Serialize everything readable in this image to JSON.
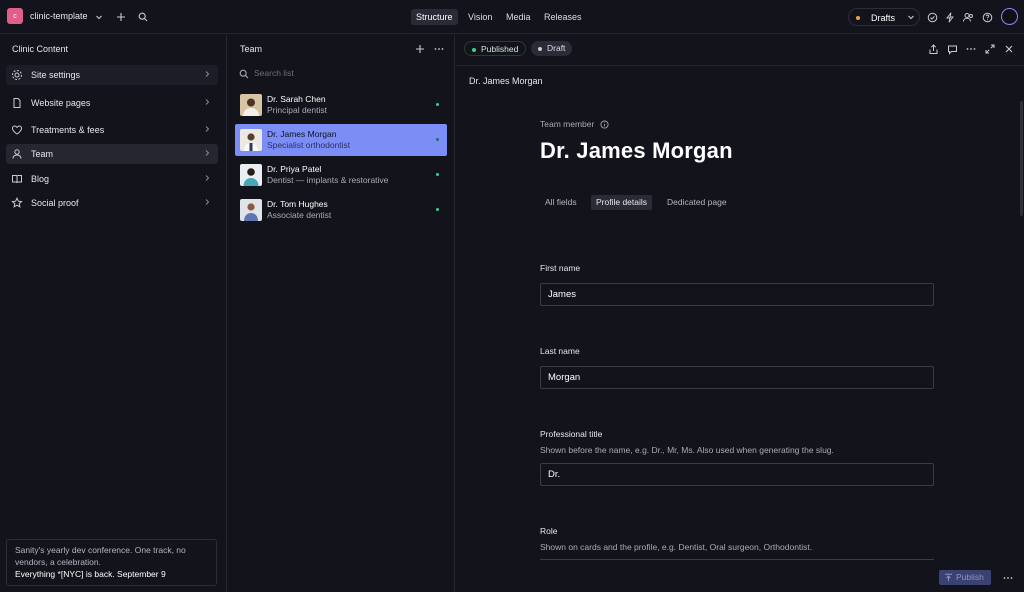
{
  "topbar": {
    "logo_letter": "c",
    "project": "clinic-template",
    "tabs": [
      "Structure",
      "Vision",
      "Media",
      "Releases"
    ],
    "active_tab": "Structure",
    "perspective": "Drafts"
  },
  "sidebar": {
    "title": "Clinic Content",
    "items": [
      {
        "label": "Site settings",
        "icon": "gear-icon"
      },
      {
        "label": "Website pages",
        "icon": "document-icon"
      },
      {
        "label": "Treatments & fees",
        "icon": "heart-icon"
      },
      {
        "label": "Team",
        "icon": "user-icon"
      },
      {
        "label": "Blog",
        "icon": "book-icon"
      },
      {
        "label": "Social proof",
        "icon": "star-icon"
      }
    ],
    "selected": "Team",
    "banner": {
      "text": "Sanity's yearly dev conference. One track, no vendors, a celebration.",
      "strong": "Everything *[NYC] is back. September 9"
    }
  },
  "team_list": {
    "title": "Team",
    "search_placeholder": "Search list",
    "items": [
      {
        "name": "Dr. Sarah Chen",
        "role": "Principal dentist",
        "thumb_color": "#c7a77f"
      },
      {
        "name": "Dr. James Morgan",
        "role": "Specialist orthodontist",
        "thumb_color": "#e7e3df"
      },
      {
        "name": "Dr. Priya Patel",
        "role": "Dentist — implants & restorative",
        "thumb_color": "#5aa8b4"
      },
      {
        "name": "Dr. Tom Hughes",
        "role": "Associate dentist",
        "thumb_color": "#6a7fb4"
      }
    ],
    "selected": "Dr. James Morgan"
  },
  "document": {
    "status_published": "Published",
    "status_draft": "Draft",
    "title": "Dr. James Morgan",
    "type_label": "Team member",
    "heading": "Dr. James Morgan",
    "tabs": [
      "All fields",
      "Profile details",
      "Dedicated page"
    ],
    "active_tab": "Profile details",
    "fields": {
      "first_name": {
        "label": "First name",
        "value": "James"
      },
      "last_name": {
        "label": "Last name",
        "value": "Morgan"
      },
      "professional_title": {
        "label": "Professional title",
        "description": "Shown before the name, e.g. Dr., Mr, Ms. Also used when generating the slug.",
        "value": "Dr."
      },
      "role": {
        "label": "Role",
        "description": "Shown on cards and the profile, e.g. Dentist, Oral surgeon, Orthodontist."
      }
    },
    "publish_label": "Publish"
  },
  "colors": {
    "background": "#13141b",
    "selected_row": "#7b8ef5",
    "published_dot": "#3ccf88",
    "drafts_dot": "#f2a03d"
  }
}
